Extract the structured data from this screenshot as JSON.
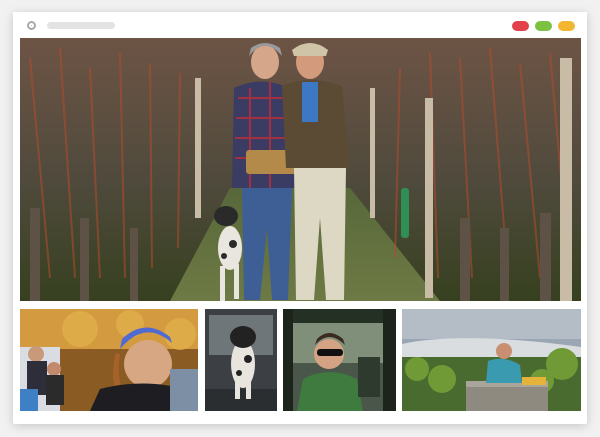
{
  "window": {
    "buttons": [
      "close",
      "maximize",
      "minimize"
    ],
    "colors": {
      "red": "#e2414b",
      "green": "#7cc142",
      "yellow": "#f2b632"
    }
  },
  "gallery": {
    "hero": {
      "subject": "couple-with-dog-in-vineyard"
    },
    "thumbnails": [
      {
        "subject": "woman-smiling-autumn-vines"
      },
      {
        "subject": "dog-at-window"
      },
      {
        "subject": "woman-in-vehicle"
      },
      {
        "subject": "worker-in-vineyard"
      }
    ]
  }
}
